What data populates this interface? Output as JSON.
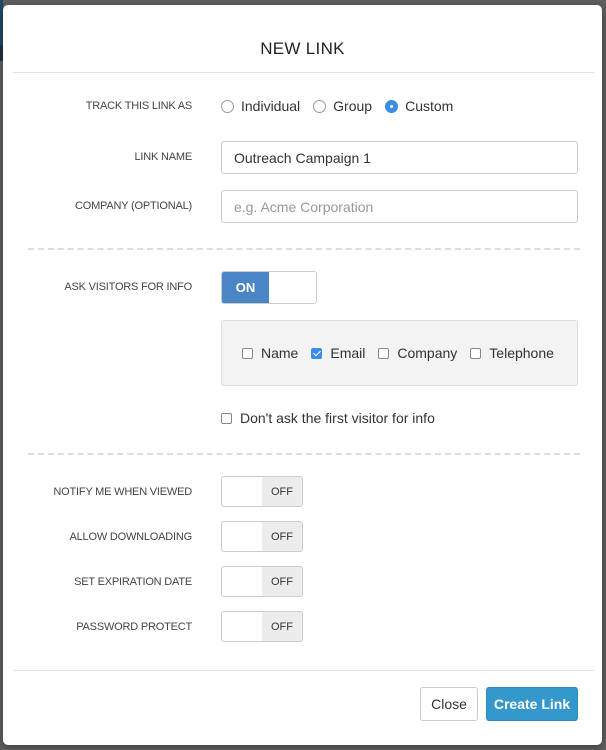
{
  "modal": {
    "title": "NEW LINK"
  },
  "track": {
    "label": "TRACK THIS LINK AS",
    "options": [
      {
        "label": "Individual",
        "checked": false
      },
      {
        "label": "Group",
        "checked": false
      },
      {
        "label": "Custom",
        "checked": true
      }
    ]
  },
  "link_name": {
    "label": "LINK NAME",
    "value": "Outreach Campaign 1",
    "placeholder": ""
  },
  "company": {
    "label": "COMPANY (OPTIONAL)",
    "value": "",
    "placeholder": "e.g. Acme Corporation"
  },
  "ask_visitors": {
    "label": "ASK VISITORS FOR INFO",
    "state": "ON",
    "fields": [
      {
        "label": "Name",
        "checked": false
      },
      {
        "label": "Email",
        "checked": true
      },
      {
        "label": "Company",
        "checked": false
      },
      {
        "label": "Telephone",
        "checked": false
      }
    ],
    "first_visitor": {
      "label": "Don't ask the first visitor for info",
      "checked": false
    }
  },
  "settings": [
    {
      "label": "NOTIFY ME WHEN VIEWED",
      "state": "OFF"
    },
    {
      "label": "ALLOW DOWNLOADING",
      "state": "OFF"
    },
    {
      "label": "SET EXPIRATION DATE",
      "state": "OFF"
    },
    {
      "label": "PASSWORD PROTECT",
      "state": "OFF"
    }
  ],
  "footer": {
    "close_label": "Close",
    "create_label": "Create Link"
  },
  "colors": {
    "accent": "#3b8de6",
    "toggle_on": "#4a86c5",
    "primary_button": "#3598cd"
  }
}
